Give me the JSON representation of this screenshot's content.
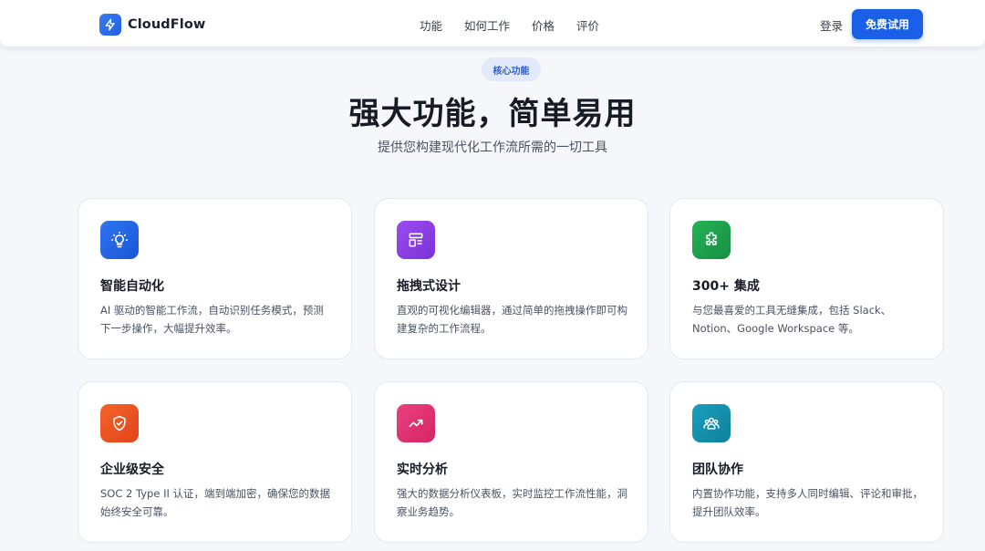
{
  "nav": {
    "brand": "CloudFlow",
    "links": [
      "功能",
      "如何工作",
      "价格",
      "评价"
    ],
    "login": "登录",
    "cta": "免费试用"
  },
  "hero": {
    "badge": "核心功能",
    "title": "强大功能，简单易用",
    "subtitle": "提供您构建现代化工作流所需的一切工具"
  },
  "features": [
    {
      "title": "智能自动化",
      "desc": "AI 驱动的智能工作流，自动识别任务模式，预测下一步操作，大幅提升效率。",
      "icon": "lightbulb-icon",
      "color": "#1f62e6"
    },
    {
      "title": "拖拽式设计",
      "desc": "直观的可视化编辑器，通过简单的拖拽操作即可构建复杂的工作流程。",
      "icon": "layout-icon",
      "color": "#8a3fe0"
    },
    {
      "title": "300+ 集成",
      "desc": "与您最喜爱的工具无缝集成，包括 Slack、Notion、Google Workspace 等。",
      "icon": "puzzle-icon",
      "color": "#1fa34d"
    },
    {
      "title": "企业级安全",
      "desc": "SOC 2 Type II 认证，端到端加密，确保您的数据始终安全可靠。",
      "icon": "shield-check-icon",
      "color": "#f0531f"
    },
    {
      "title": "实时分析",
      "desc": "强大的数据分析仪表板，实时监控工作流性能，洞察业务趋势。",
      "icon": "trending-up-icon",
      "color": "#e0306e"
    },
    {
      "title": "团队协作",
      "desc": "内置协作功能，支持多人同时编辑、评论和审批，提升团队效率。",
      "icon": "users-icon",
      "color": "#118ba8"
    }
  ]
}
